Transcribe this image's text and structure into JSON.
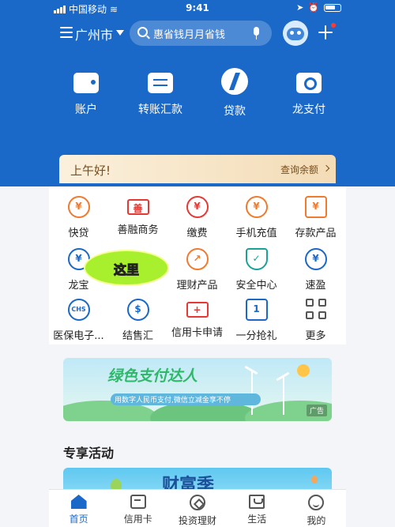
{
  "colors": {
    "primary": "#1a68c8",
    "accent": "#f07a2e",
    "greeting_bg": "#f3dcb6",
    "highlight": "#a8f02e"
  },
  "status_bar": {
    "carrier": "中国移动",
    "time": "9:41"
  },
  "header": {
    "city": "广州市",
    "search_placeholder": "惠省钱月月省钱",
    "quick_actions": [
      {
        "label": "账户",
        "icon": "wallet-icon"
      },
      {
        "label": "转账汇款",
        "icon": "transfer-icon"
      },
      {
        "label": "贷款",
        "icon": "loan-icon"
      },
      {
        "label": "龙支付",
        "icon": "dragon-pay-icon"
      }
    ]
  },
  "greeting": {
    "text": "上午好!",
    "link": "查询余额"
  },
  "services": {
    "row1": [
      {
        "label": "快贷",
        "icon": "quick-loan-icon",
        "glyph": "¥"
      },
      {
        "label": "善融商务",
        "icon": "shanrong-icon",
        "glyph": "善"
      },
      {
        "label": "缴费",
        "icon": "payment-icon",
        "glyph": "¥"
      },
      {
        "label": "手机充值",
        "icon": "phone-topup-icon",
        "glyph": "¥"
      },
      {
        "label": "存款产品",
        "icon": "deposit-icon",
        "glyph": "¥"
      }
    ],
    "row2": [
      {
        "label": "龙宝",
        "icon": "longbao-icon",
        "glyph": "¥"
      },
      {
        "label": "",
        "icon": "hidden-service-icon",
        "glyph": ""
      },
      {
        "label": "理财产品",
        "icon": "wealth-icon",
        "glyph": "↗"
      },
      {
        "label": "安全中心",
        "icon": "security-icon",
        "glyph": "✓"
      },
      {
        "label": "速盈",
        "icon": "suying-icon",
        "glyph": "¥"
      }
    ],
    "row3": [
      {
        "label": "医保电子...",
        "icon": "medical-insurance-icon",
        "glyph": "CHS"
      },
      {
        "label": "结售汇",
        "icon": "exchange-icon",
        "glyph": "$"
      },
      {
        "label": "信用卡申请",
        "icon": "credit-card-apply-icon",
        "glyph": "+"
      },
      {
        "label": "一分抢礼",
        "icon": "gift-ticket-icon",
        "glyph": "1"
      },
      {
        "label": "更多",
        "icon": "more-icon",
        "glyph": ""
      }
    ]
  },
  "annotation": {
    "text": "这里"
  },
  "banner": {
    "title": "绿色支付达人",
    "subtitle": "用数字人民币支付,微信立减金享不停",
    "tag": "广告"
  },
  "section": {
    "title": "专享活动"
  },
  "promo": {
    "title": "财富季"
  },
  "tabs": [
    {
      "label": "首页",
      "icon": "home-icon",
      "active": true
    },
    {
      "label": "信用卡",
      "icon": "credit-card-icon",
      "active": false
    },
    {
      "label": "投资理财",
      "icon": "invest-icon",
      "active": false
    },
    {
      "label": "生活",
      "icon": "life-icon",
      "active": false
    },
    {
      "label": "我的",
      "icon": "profile-icon",
      "active": false
    }
  ]
}
